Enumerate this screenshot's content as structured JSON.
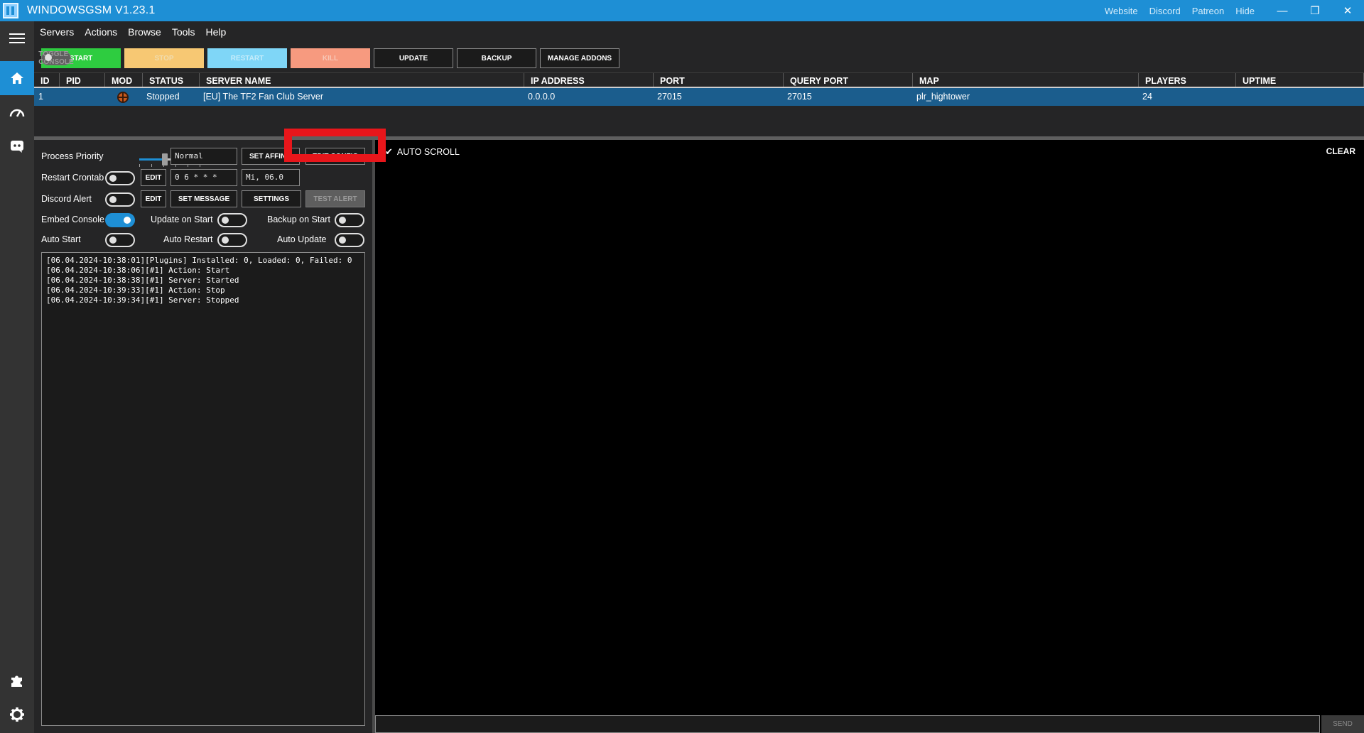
{
  "titlebar": {
    "title": "WINDOWSGSM V1.23.1",
    "links": [
      "Website",
      "Discord",
      "Patreon",
      "Hide"
    ],
    "minimize": "—",
    "restore": "❐",
    "close": "✕"
  },
  "menu": [
    "Servers",
    "Actions",
    "Browse",
    "Tools",
    "Help"
  ],
  "toolbar": {
    "start": "START",
    "stop": "STOP",
    "restart": "RESTART",
    "kill": "KILL",
    "toggle_console": "TOGGLE CONSOLE",
    "update": "UPDATE",
    "backup": "BACKUP",
    "manage_addons": "MANAGE ADDONS"
  },
  "table": {
    "columns": [
      "ID",
      "PID",
      "MOD",
      "STATUS",
      "SERVER NAME",
      "IP ADDRESS",
      "PORT",
      "QUERY PORT",
      "MAP",
      "PLAYERS",
      "UPTIME"
    ],
    "rows": [
      {
        "id": "1",
        "pid": "",
        "mod_icon": "tf2-icon",
        "status": "Stopped",
        "server_name": "[EU] The TF2 Fan Club Server",
        "ip": "0.0.0.0",
        "port": "27015",
        "query_port": "27015",
        "map": "plr_hightower",
        "players": "24",
        "uptime": ""
      }
    ]
  },
  "panel": {
    "process_priority_label": "Process Priority",
    "priority_value": "Normal",
    "set_affinity": "SET AFFINI",
    "edit_config": "EDIT CONFIG",
    "restart_crontab_label": "Restart Crontab",
    "crontab_edit": "EDIT",
    "crontab_value": "0 6 * * *",
    "crontab_next": "Mi, 06.0",
    "discord_alert_label": "Discord Alert",
    "discord_edit": "EDIT",
    "set_message": "SET MESSAGE",
    "settings": "SETTINGS",
    "test_alert": "TEST ALERT",
    "embed_console_label": "Embed Console",
    "update_on_start_label": "Update on Start",
    "backup_on_start_label": "Backup on Start",
    "auto_start_label": "Auto Start",
    "auto_restart_label": "Auto Restart",
    "auto_update_label": "Auto Update"
  },
  "toggles": {
    "restart_crontab": false,
    "discord_alert": false,
    "embed_console": true,
    "update_on_start": false,
    "backup_on_start": false,
    "auto_start": false,
    "auto_restart": false,
    "auto_update": false
  },
  "log": [
    "[06.04.2024-10:38:01][Plugins] Installed: 0, Loaded: 0, Failed: 0",
    "[06.04.2024-10:38:06][#1] Action: Start",
    "[06.04.2024-10:38:38][#1] Server: Started",
    "[06.04.2024-10:39:33][#1] Action: Stop",
    "[06.04.2024-10:39:34][#1] Server: Stopped"
  ],
  "console": {
    "auto_scroll": "AUTO SCROLL",
    "clear": "CLEAR",
    "send": "SEND"
  },
  "colors": {
    "accent": "#1e8fd5",
    "start": "#2ecc40",
    "stop": "#f7c873",
    "restart": "#7fd6f7",
    "kill": "#f79a7f",
    "highlight": "#e8161b",
    "selected_row": "#1b5d8d"
  }
}
